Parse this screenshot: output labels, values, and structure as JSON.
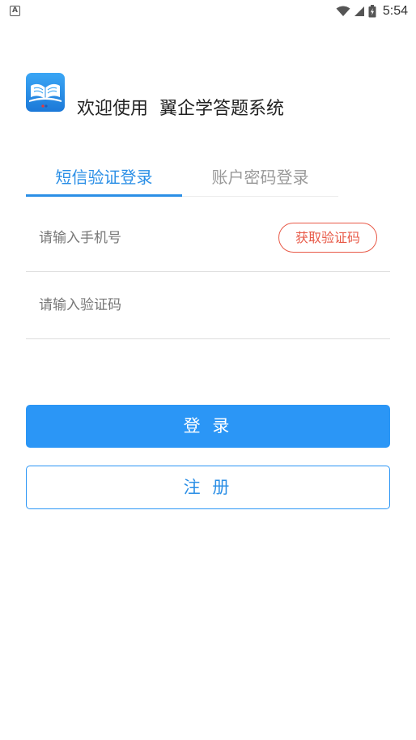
{
  "status_bar": {
    "notification_icon": "A",
    "time": "5:54",
    "icons": [
      "wifi-icon",
      "cell-signal-icon",
      "battery-charging-icon"
    ]
  },
  "header": {
    "logo_icon": "open-book-app-icon",
    "welcome_text": "欢迎使用  翼企学答题系统"
  },
  "tabs": [
    {
      "label": "短信验证登录",
      "active": true
    },
    {
      "label": "账户密码登录",
      "active": false
    }
  ],
  "form": {
    "phone_placeholder": "请输入手机号",
    "phone_value": "",
    "get_code_label": "获取验证码",
    "code_placeholder": "请输入验证码",
    "code_value": ""
  },
  "actions": {
    "login_label": "登 录",
    "register_label": "注 册"
  },
  "colors": {
    "accent": "#2b96f6",
    "tab_active": "#2b8fe6",
    "tab_inactive": "#999999",
    "get_code": "#e85a48"
  }
}
